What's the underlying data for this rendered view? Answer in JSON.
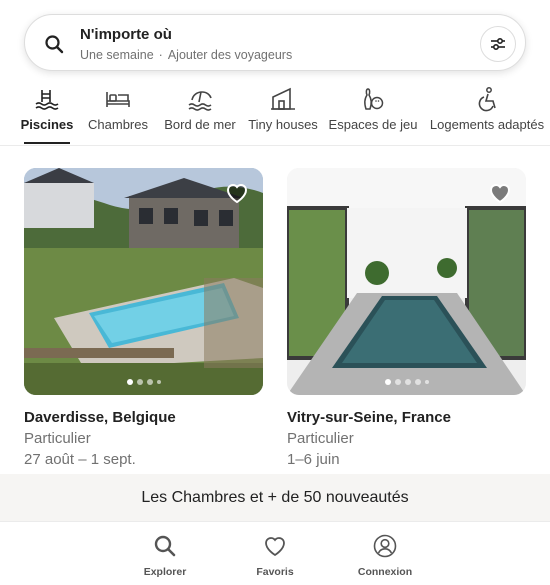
{
  "search": {
    "title": "N'importe où",
    "dates": "Une semaine",
    "separator": "·",
    "guests": "Ajouter des voyageurs"
  },
  "categories": [
    {
      "label": "Piscines",
      "icon": "pool-icon",
      "active": true
    },
    {
      "label": "Chambres",
      "icon": "bed-icon",
      "active": false
    },
    {
      "label": "Bord de mer",
      "icon": "beach-icon",
      "active": false
    },
    {
      "label": "Tiny houses",
      "icon": "tiny-house-icon",
      "active": false
    },
    {
      "label": "Espaces de jeu",
      "icon": "bowling-icon",
      "active": false
    },
    {
      "label": "Logements adaptés",
      "icon": "accessible-icon",
      "active": false
    }
  ],
  "listings": [
    {
      "location": "Daverdisse, Belgique",
      "host_type": "Particulier",
      "dates": "27 août – 1 sept.",
      "photo": "house-with-outdoor-pool",
      "active_dot": 1
    },
    {
      "location": "Vitry-sur-Seine, France",
      "host_type": "Particulier",
      "dates": "1–6 juin",
      "photo": "indoor-pool-room",
      "active_dot": 1
    }
  ],
  "banner": {
    "text": "Les Chambres et + de 50 nouveautés"
  },
  "bottom_nav": [
    {
      "label": "Explorer",
      "icon": "search-icon"
    },
    {
      "label": "Favoris",
      "icon": "heart-outline-icon"
    },
    {
      "label": "Connexion",
      "icon": "user-circle-icon"
    }
  ],
  "colors": {
    "text": "#222222",
    "muted": "#717171",
    "border": "#dddddd",
    "banner_bg": "#f6f5f3"
  }
}
